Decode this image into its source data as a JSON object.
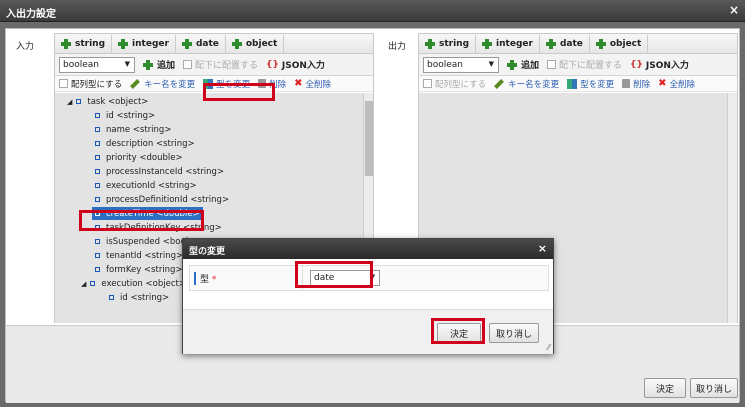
{
  "window": {
    "title": "入出力設定",
    "close": "×"
  },
  "input_side_label": "入力",
  "output_side_label": "出力",
  "toolbar": {
    "string": "string",
    "integer": "integer",
    "date": "date",
    "object": "object"
  },
  "row2": {
    "type_value": "boolean",
    "add": "追加",
    "place_under": "配下に配置する",
    "json_input": "JSON入力"
  },
  "row3": {
    "array_type": "配列型にする",
    "rename_key": "キー名を変更",
    "change_type": "型を変更",
    "delete": "削除",
    "delete_all": "全削除"
  },
  "tree": [
    {
      "label": "task <object>"
    },
    {
      "label": "id <string>"
    },
    {
      "label": "name <string>"
    },
    {
      "label": "description <string>"
    },
    {
      "label": "priority <double>"
    },
    {
      "label": "processInstanceId <string>"
    },
    {
      "label": "executionId <string>"
    },
    {
      "label": "processDefinitionId <string>"
    },
    {
      "label": "createTime <double>"
    },
    {
      "label": "taskDefinitionKey <string>"
    },
    {
      "label": "isSuspended <boolean>"
    },
    {
      "label": "tenantId <string>"
    },
    {
      "label": "formKey <string>"
    },
    {
      "label": "execution <object>"
    },
    {
      "label": "id <string>"
    }
  ],
  "footer": {
    "ok": "決定",
    "cancel": "取り消し"
  },
  "modal": {
    "title": "型の変更",
    "close": "×",
    "field_label": "型",
    "required_mark": "*",
    "field_value": "date",
    "ok": "決定",
    "cancel": "取り消し"
  },
  "colors": {
    "highlight_box": "#d0021b",
    "selection": "#2d6fc3",
    "add_icon": "#2e8b2e"
  }
}
